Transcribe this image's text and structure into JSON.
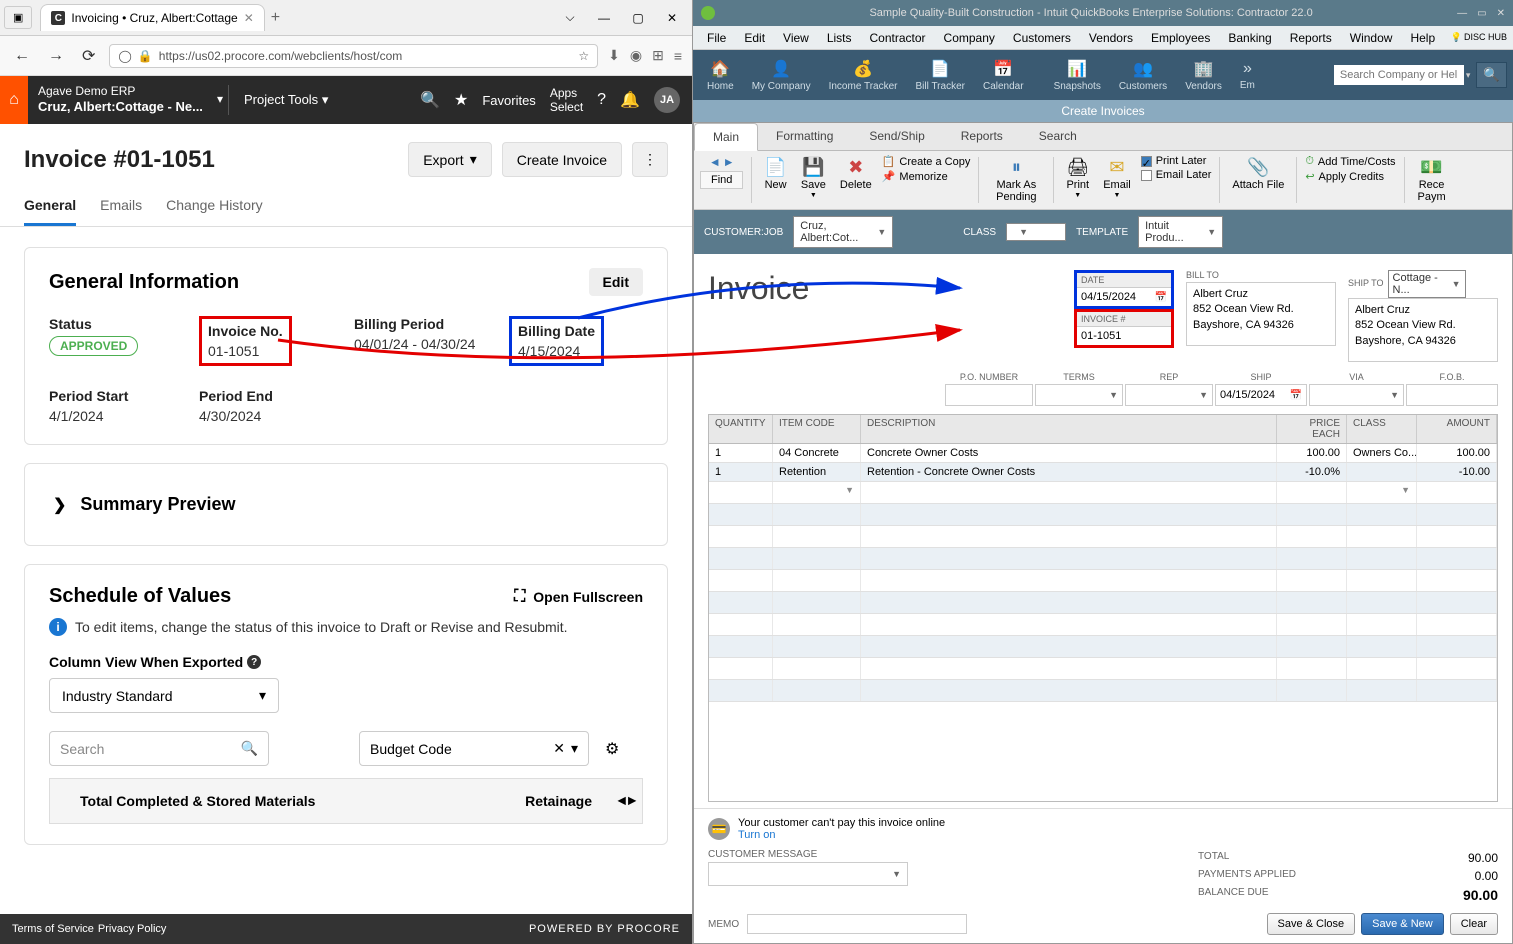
{
  "browser": {
    "tab_title": "Invoicing • Cruz, Albert:Cottage",
    "url": "https://us02.procore.com/webclients/host/com",
    "favorites": "Favorites",
    "apps": "Apps",
    "select": "Select"
  },
  "procore": {
    "company": "Agave Demo ERP",
    "project": "Cruz, Albert:Cottage - Ne...",
    "tools": "Project Tools",
    "user": "JA"
  },
  "invoice": {
    "title": "Invoice #01-1051",
    "export": "Export",
    "create": "Create Invoice",
    "tabs": {
      "general": "General",
      "emails": "Emails",
      "history": "Change History"
    }
  },
  "general": {
    "heading": "General Information",
    "edit": "Edit",
    "status_label": "Status",
    "status_value": "APPROVED",
    "invoice_no_label": "Invoice No.",
    "invoice_no_value": "01-1051",
    "billing_period_label": "Billing Period",
    "billing_period_value": "04/01/24 - 04/30/24",
    "billing_date_label": "Billing Date",
    "billing_date_value": "4/15/2024",
    "period_start_label": "Period Start",
    "period_start_value": "4/1/2024",
    "period_end_label": "Period End",
    "period_end_value": "4/30/2024"
  },
  "summary": {
    "title": "Summary Preview"
  },
  "sov": {
    "title": "Schedule of Values",
    "fullscreen": "Open Fullscreen",
    "desc": "To edit items, change the status of this invoice to Draft or Revise and Resubmit.",
    "export_label": "Column View When Exported",
    "export_value": "Industry Standard",
    "search": "Search",
    "budget": "Budget Code",
    "col1": "Total Completed & Stored Materials",
    "col2": "Retainage"
  },
  "footer": {
    "terms": "Terms of Service",
    "privacy": "Privacy Policy",
    "powered": "POWERED BY PROCORE"
  },
  "qb": {
    "title": "Sample Quality-Built Construction - Intuit QuickBooks Enterprise Solutions: Contractor 22.0",
    "menus": [
      "File",
      "Edit",
      "View",
      "Lists",
      "Contractor",
      "Company",
      "Customers",
      "Vendors",
      "Employees",
      "Banking",
      "Reports",
      "Window",
      "Help"
    ],
    "disc_hub": "DISC HUB",
    "tools": {
      "home": "Home",
      "mycompany": "My Company",
      "income": "Income Tracker",
      "bill": "Bill Tracker",
      "calendar": "Calendar",
      "snapshots": "Snapshots",
      "customers": "Customers",
      "vendors": "Vendors",
      "em": "Em"
    },
    "search_placeholder": "Search Company or Help",
    "window_title": "Create Invoices",
    "tabs": {
      "main": "Main",
      "formatting": "Formatting",
      "send": "Send/Ship",
      "reports": "Reports",
      "search": "Search"
    },
    "ribbon": {
      "find": "Find",
      "new": "New",
      "save": "Save",
      "delete": "Delete",
      "copy": "Create a Copy",
      "memorize": "Memorize",
      "pending": "Mark As Pending",
      "print": "Print",
      "email": "Email",
      "print_later": "Print Later",
      "email_later": "Email Later",
      "attach": "Attach File",
      "timecosts": "Add Time/Costs",
      "credits": "Apply Credits",
      "receive": "Rece Paym"
    },
    "cust_label": "CUSTOMER:JOB",
    "cust_value": "Cruz, Albert:Cot...",
    "class_label": "CLASS",
    "template_label": "TEMPLATE",
    "template_value": "Intuit Produ...",
    "invoice_word": "Invoice",
    "date_label": "DATE",
    "date_value": "04/15/2024",
    "invno_label": "INVOICE #",
    "invno_value": "01-1051",
    "billto_label": "BILL TO",
    "shipto_label": "SHIP TO",
    "shipto_select": "Cottage - N...",
    "addr_name": "Albert Cruz",
    "addr_line1": "852 Ocean View Rd.",
    "addr_line2": "Bayshore, CA 94326",
    "po_labels": {
      "po": "P.O. NUMBER",
      "terms": "TERMS",
      "rep": "REP",
      "ship": "SHIP",
      "via": "VIA",
      "fob": "F.O.B."
    },
    "ship_date": "04/15/2024",
    "cols": {
      "qty": "QUANTITY",
      "item": "ITEM CODE",
      "desc": "DESCRIPTION",
      "price": "PRICE EACH",
      "class": "CLASS",
      "amt": "AMOUNT"
    },
    "rows": [
      {
        "qty": "1",
        "item": "04 Concrete",
        "desc": "Concrete Owner Costs",
        "price": "100.00",
        "class": "Owners Co...",
        "amt": "100.00"
      },
      {
        "qty": "1",
        "item": "Retention",
        "desc": "Retention - Concrete Owner Costs",
        "price": "-10.0%",
        "class": "",
        "amt": "-10.00"
      }
    ],
    "pay_online": "Your customer can't pay this invoice online",
    "turn_on": "Turn on",
    "msg_label": "CUSTOMER MESSAGE",
    "memo_label": "MEMO",
    "totals": {
      "total": "TOTAL",
      "total_val": "90.00",
      "payments": "PAYMENTS APPLIED",
      "payments_val": "0.00",
      "balance": "BALANCE DUE",
      "balance_val": "90.00"
    },
    "btns": {
      "saveclose": "Save & Close",
      "savenew": "Save & New",
      "clear": "Clear"
    }
  }
}
